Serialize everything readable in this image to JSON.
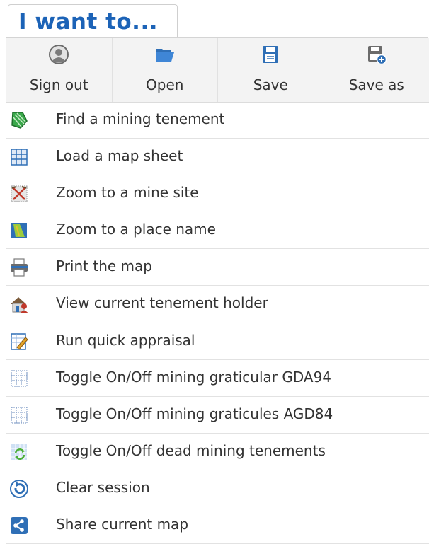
{
  "header": {
    "title": "I want to..."
  },
  "toolbar": {
    "buttons": [
      {
        "label": "Sign out",
        "icon": "user-icon"
      },
      {
        "label": "Open",
        "icon": "folder-open-icon"
      },
      {
        "label": "Save",
        "icon": "floppy-disk-icon"
      },
      {
        "label": "Save as",
        "icon": "floppy-disk-plus-icon"
      }
    ]
  },
  "menu": {
    "items": [
      {
        "label": "Find a mining tenement",
        "icon": "tenement-polygon-icon"
      },
      {
        "label": "Load a map sheet",
        "icon": "map-grid-icon"
      },
      {
        "label": "Zoom to a mine site",
        "icon": "mine-site-icon"
      },
      {
        "label": "Zoom to a place name",
        "icon": "place-map-icon"
      },
      {
        "label": "Print the map",
        "icon": "printer-icon"
      },
      {
        "label": "View current tenement holder",
        "icon": "holder-house-icon"
      },
      {
        "label": "Run quick appraisal",
        "icon": "appraisal-pencil-icon"
      },
      {
        "label": "Toggle On/Off mining graticular GDA94",
        "icon": "graticule-grid-icon"
      },
      {
        "label": "Toggle On/Off mining graticules AGD84",
        "icon": "graticule-grid-icon"
      },
      {
        "label": "Toggle On/Off dead mining tenements",
        "icon": "refresh-tenements-icon"
      },
      {
        "label": "Clear session",
        "icon": "clear-refresh-icon"
      },
      {
        "label": "Share current map",
        "icon": "share-icon"
      }
    ]
  },
  "colors": {
    "title": "#1c63b7",
    "toolbar_bg": "#f3f3f3",
    "icon_blue": "#2f6fb6"
  }
}
